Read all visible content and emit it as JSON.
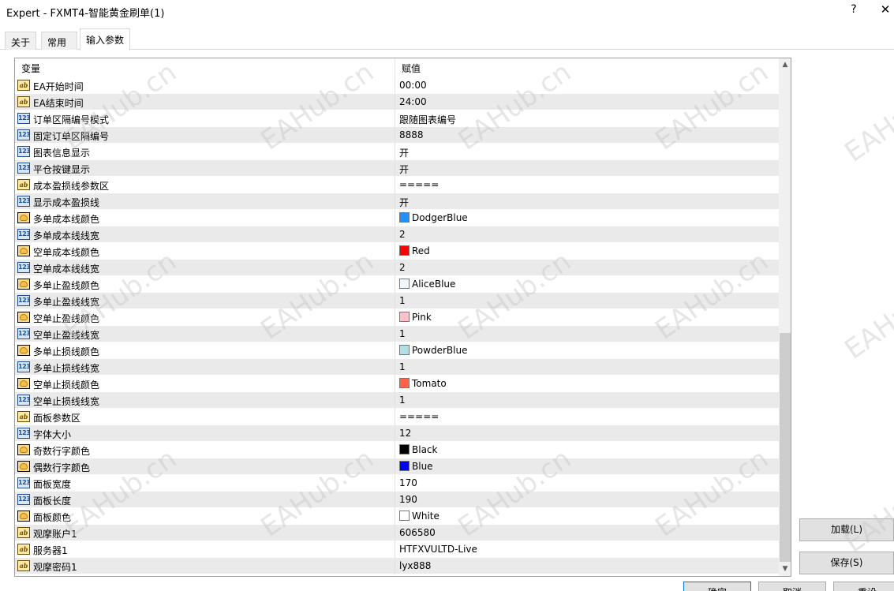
{
  "window": {
    "title": "Expert - FXMT4-智能黄金刷单(1)",
    "help_label": "?",
    "close_label": "✕"
  },
  "tabs": [
    {
      "label": "关于"
    },
    {
      "label": "常用"
    },
    {
      "label": "输入参数",
      "active": true
    }
  ],
  "grid": {
    "header_variable": "变量",
    "header_value": "赋值",
    "rows": [
      {
        "type": "ab",
        "name": "EA开始时间",
        "value": "00:00"
      },
      {
        "type": "ab",
        "name": "EA结束时间",
        "value": "24:00"
      },
      {
        "type": "123",
        "name": "订单区隔编号模式",
        "value": "跟随图表编号"
      },
      {
        "type": "123",
        "name": "固定订单区隔编号",
        "value": "8888"
      },
      {
        "type": "123",
        "name": "图表信息显示",
        "value": "开"
      },
      {
        "type": "123",
        "name": "平仓按键显示",
        "value": "开"
      },
      {
        "type": "ab",
        "name": "成本盈损线参数区",
        "value": "====="
      },
      {
        "type": "123",
        "name": "显示成本盈损线",
        "value": "开"
      },
      {
        "type": "color",
        "name": "多单成本线颜色",
        "value": "DodgerBlue",
        "swatch": "#1E90FF"
      },
      {
        "type": "123",
        "name": "多单成本线线宽",
        "value": "2"
      },
      {
        "type": "color",
        "name": "空单成本线颜色",
        "value": "Red",
        "swatch": "#FF0000"
      },
      {
        "type": "123",
        "name": "空单成本线线宽",
        "value": "2"
      },
      {
        "type": "color",
        "name": "多单止盈线颜色",
        "value": "AliceBlue",
        "swatch": "#F0F8FF"
      },
      {
        "type": "123",
        "name": "多单止盈线线宽",
        "value": "1"
      },
      {
        "type": "color",
        "name": "空单止盈线颜色",
        "value": "Pink",
        "swatch": "#FFC0CB"
      },
      {
        "type": "123",
        "name": "空单止盈线线宽",
        "value": "1"
      },
      {
        "type": "color",
        "name": "多单止损线颜色",
        "value": "PowderBlue",
        "swatch": "#B0E0E6"
      },
      {
        "type": "123",
        "name": "多单止损线线宽",
        "value": "1"
      },
      {
        "type": "color",
        "name": "空单止损线颜色",
        "value": "Tomato",
        "swatch": "#FF6347"
      },
      {
        "type": "123",
        "name": "空单止损线线宽",
        "value": "1"
      },
      {
        "type": "ab",
        "name": "面板参数区",
        "value": "====="
      },
      {
        "type": "123",
        "name": "字体大小",
        "value": "12"
      },
      {
        "type": "color",
        "name": "奇数行字颜色",
        "value": "Black",
        "swatch": "#000000"
      },
      {
        "type": "color",
        "name": "偶数行字颜色",
        "value": "Blue",
        "swatch": "#0000FF"
      },
      {
        "type": "123",
        "name": "面板宽度",
        "value": "170"
      },
      {
        "type": "123",
        "name": "面板长度",
        "value": "190"
      },
      {
        "type": "color",
        "name": "面板颜色",
        "value": "White",
        "swatch": "#FFFFFF"
      },
      {
        "type": "ab",
        "name": "观摩账户1",
        "value": "606580"
      },
      {
        "type": "ab",
        "name": "服务器1",
        "value": "HTFXVULTD-Live"
      },
      {
        "type": "ab",
        "name": "观摩密码1",
        "value": "lyx888"
      }
    ]
  },
  "buttons": {
    "load": "加载(L)",
    "save": "保存(S)",
    "ok": "确定",
    "cancel": "取消",
    "reset": "重设"
  },
  "watermark": "EAHub.cn"
}
